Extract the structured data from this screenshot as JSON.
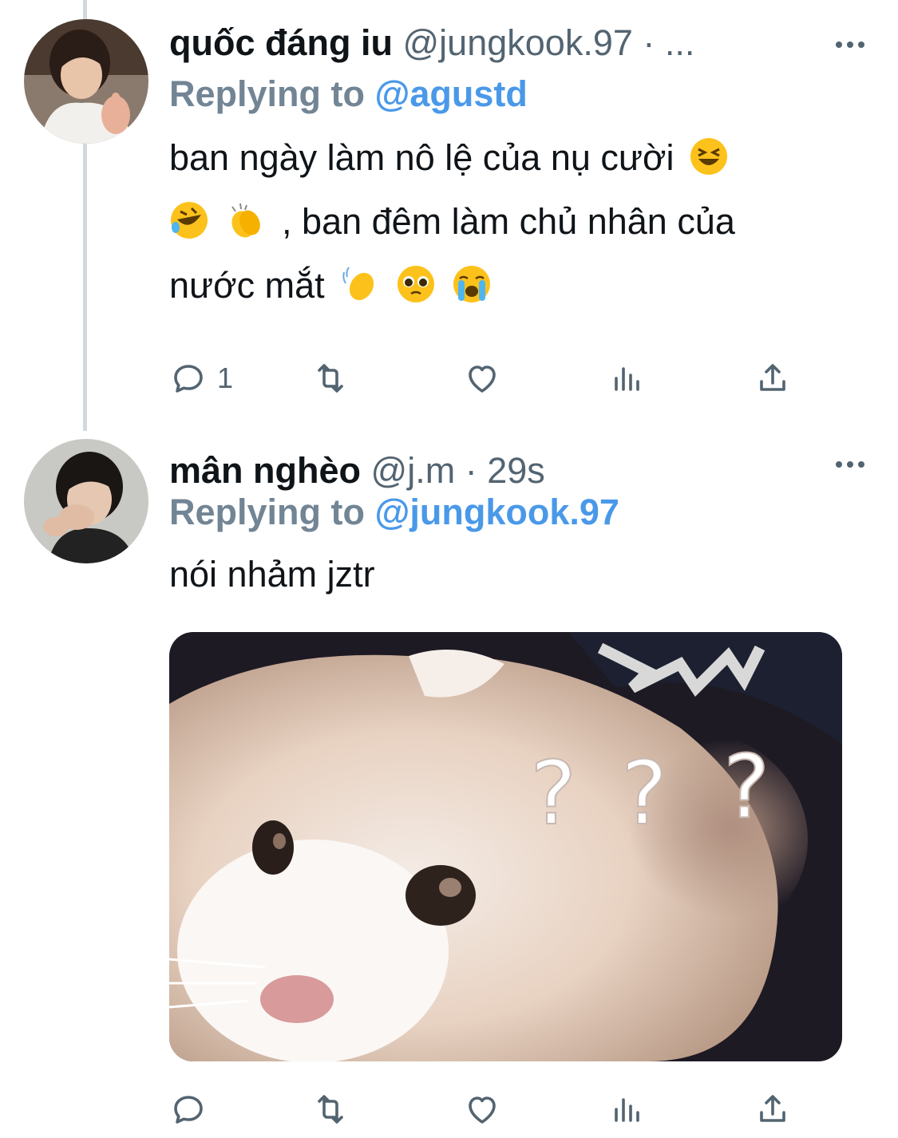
{
  "thread": {
    "tweets": [
      {
        "name": "quốc đáng iu",
        "handle": "@jungkook.97",
        "separator": "·",
        "time": "...",
        "replying_label": "Replying to",
        "replying_to": "@agustd",
        "body_line1": "ban ngày làm nô lệ của nụ cười",
        "body_line2": ", ban đêm làm chủ nhân của",
        "body_line3": "nước mắt",
        "emojis": [
          "grinning-squinting-face",
          "rolling-on-floor-laughing",
          "clapping-hands",
          "waving-hand",
          "pleading-face",
          "loudly-crying-face"
        ],
        "reply_count": "1"
      },
      {
        "name": "mân nghèo",
        "handle": "@j.m",
        "separator": "·",
        "time": "29s",
        "replying_label": "Replying to",
        "replying_to": "@jungkook.97",
        "body": "nói nhảm jztr",
        "media": {
          "description_icon": "confused-cat-meme",
          "overlay_text": [
            "?",
            "?",
            "?"
          ]
        }
      }
    ]
  },
  "icons": {
    "reply": "reply-icon",
    "retweet": "retweet-icon",
    "like": "heart-icon",
    "views": "views-icon",
    "share": "share-icon",
    "more": "more-icon"
  },
  "colors": {
    "text": "#0f1419",
    "secondary": "#536471",
    "mention": "#4a99e9",
    "replying": "#728595",
    "thread_line": "#cfd9de"
  }
}
